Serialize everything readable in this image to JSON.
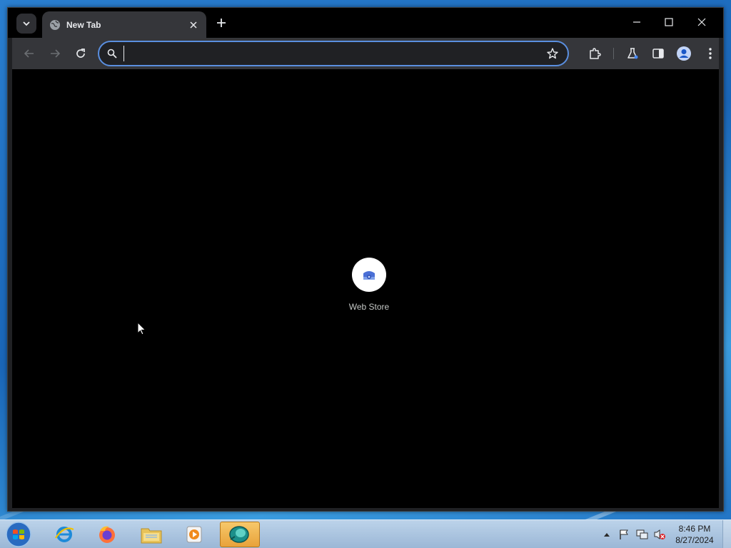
{
  "browser": {
    "tab": {
      "title": "New Tab"
    },
    "omnibox": {
      "value": "",
      "placeholder": ""
    },
    "shortcuts": [
      {
        "label": "Web Store"
      }
    ]
  },
  "taskbar": {
    "clock": {
      "time": "8:46 PM",
      "date": "8/27/2024"
    },
    "apps": [
      "internet-explorer",
      "firefox",
      "file-explorer",
      "media-player",
      "active-app"
    ]
  },
  "colors": {
    "omnibox_focus": "#5a8fe0",
    "webstore_icon": "#4a6fd6"
  }
}
